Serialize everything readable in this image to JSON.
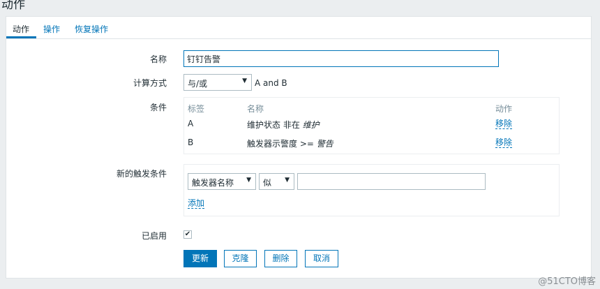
{
  "page": {
    "title": "动作"
  },
  "tabs": [
    {
      "label": "动作",
      "active": true
    },
    {
      "label": "操作",
      "active": false
    },
    {
      "label": "恢复操作",
      "active": false
    }
  ],
  "form": {
    "name_label": "名称",
    "name_value": "钉钉告警",
    "calc_label": "计算方式",
    "calc_value": "与/或",
    "calc_expression": "A and B",
    "conditions_label": "条件",
    "conditions": {
      "headers": {
        "label": "标签",
        "name": "名称",
        "action": "动作"
      },
      "rows": [
        {
          "label": "A",
          "name_prefix": "维护状态 非在 ",
          "name_value": "维护",
          "action": "移除"
        },
        {
          "label": "B",
          "name_prefix": "触发器示警度 >= ",
          "name_value": "警告",
          "action": "移除"
        }
      ]
    },
    "new_condition_label": "新的触发条件",
    "new_condition": {
      "type_value": "触发器名称",
      "operator_value": "似",
      "value": "",
      "add_label": "添加"
    },
    "enabled_label": "已启用",
    "enabled": true
  },
  "buttons": {
    "update": "更新",
    "clone": "克隆",
    "delete": "删除",
    "cancel": "取消"
  },
  "watermark": "@51CTO博客",
  "colors": {
    "accent": "#0275b8",
    "background": "#ebeef0",
    "text": "#1f2c33",
    "muted": "#768d99"
  }
}
